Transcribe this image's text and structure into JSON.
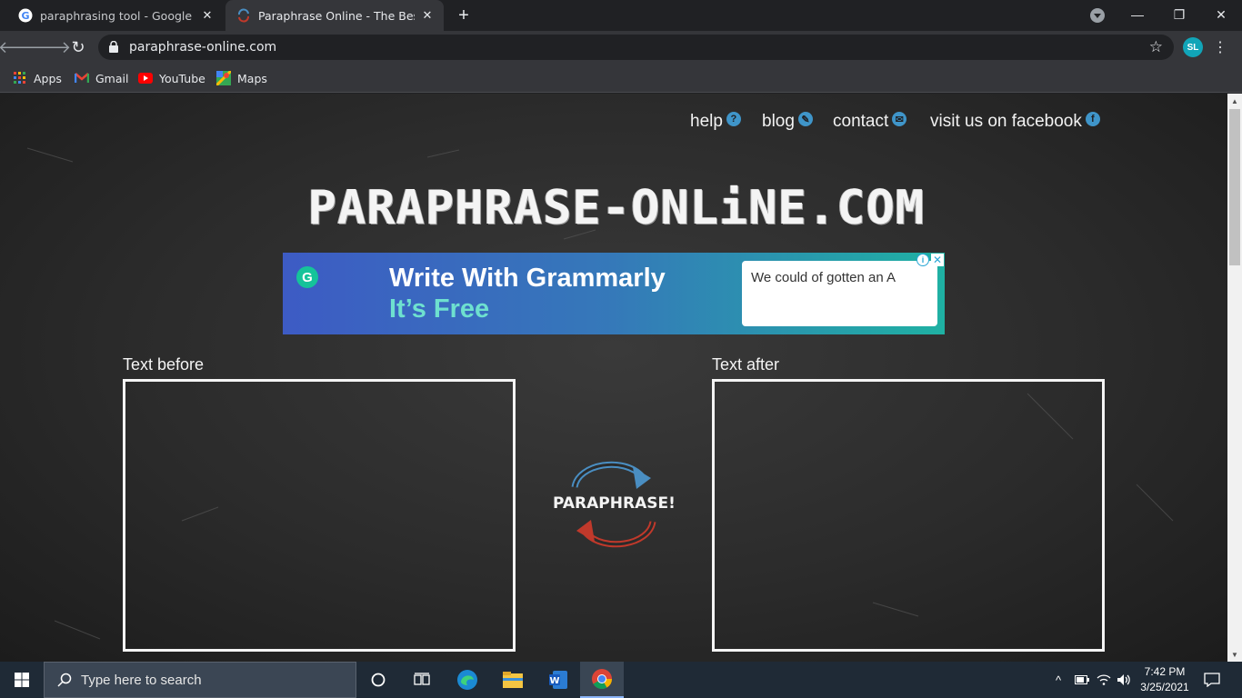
{
  "browser": {
    "tabs": [
      {
        "title": "paraphrasing tool - Google Searc",
        "active": false
      },
      {
        "title": "Paraphrase Online - The Best Free",
        "active": true
      }
    ],
    "new_tab": "+",
    "window_controls": {
      "minimize": "—",
      "restore": "❐",
      "close": "✕"
    },
    "url": "paraphrase-online.com",
    "profile_initials": "SL",
    "bookmarks": [
      {
        "label": "Apps",
        "icon": "apps-grid-icon"
      },
      {
        "label": "Gmail",
        "icon": "gmail-icon"
      },
      {
        "label": "YouTube",
        "icon": "youtube-icon"
      },
      {
        "label": "Maps",
        "icon": "maps-icon"
      }
    ]
  },
  "site": {
    "nav": [
      {
        "label": "help",
        "icon": "?"
      },
      {
        "label": "blog",
        "icon": "✎"
      },
      {
        "label": "contact",
        "icon": "✉"
      },
      {
        "label": "visit us on facebook",
        "icon": "f"
      }
    ],
    "logo": "PARAPHRASE-ONLiNE.COM",
    "ad": {
      "headline": "Write With Grammarly",
      "subline": "It’s Free",
      "sample_text": "We could of gotten an A",
      "brand_letter": "G",
      "info": "i",
      "close": "✕"
    },
    "text_before_label": "Text before",
    "text_after_label": "Text after",
    "paraphrase_button": "PARAPHRASE!"
  },
  "taskbar": {
    "search_placeholder": "Type here to search",
    "time": "7:42 PM",
    "date": "3/25/2021"
  }
}
